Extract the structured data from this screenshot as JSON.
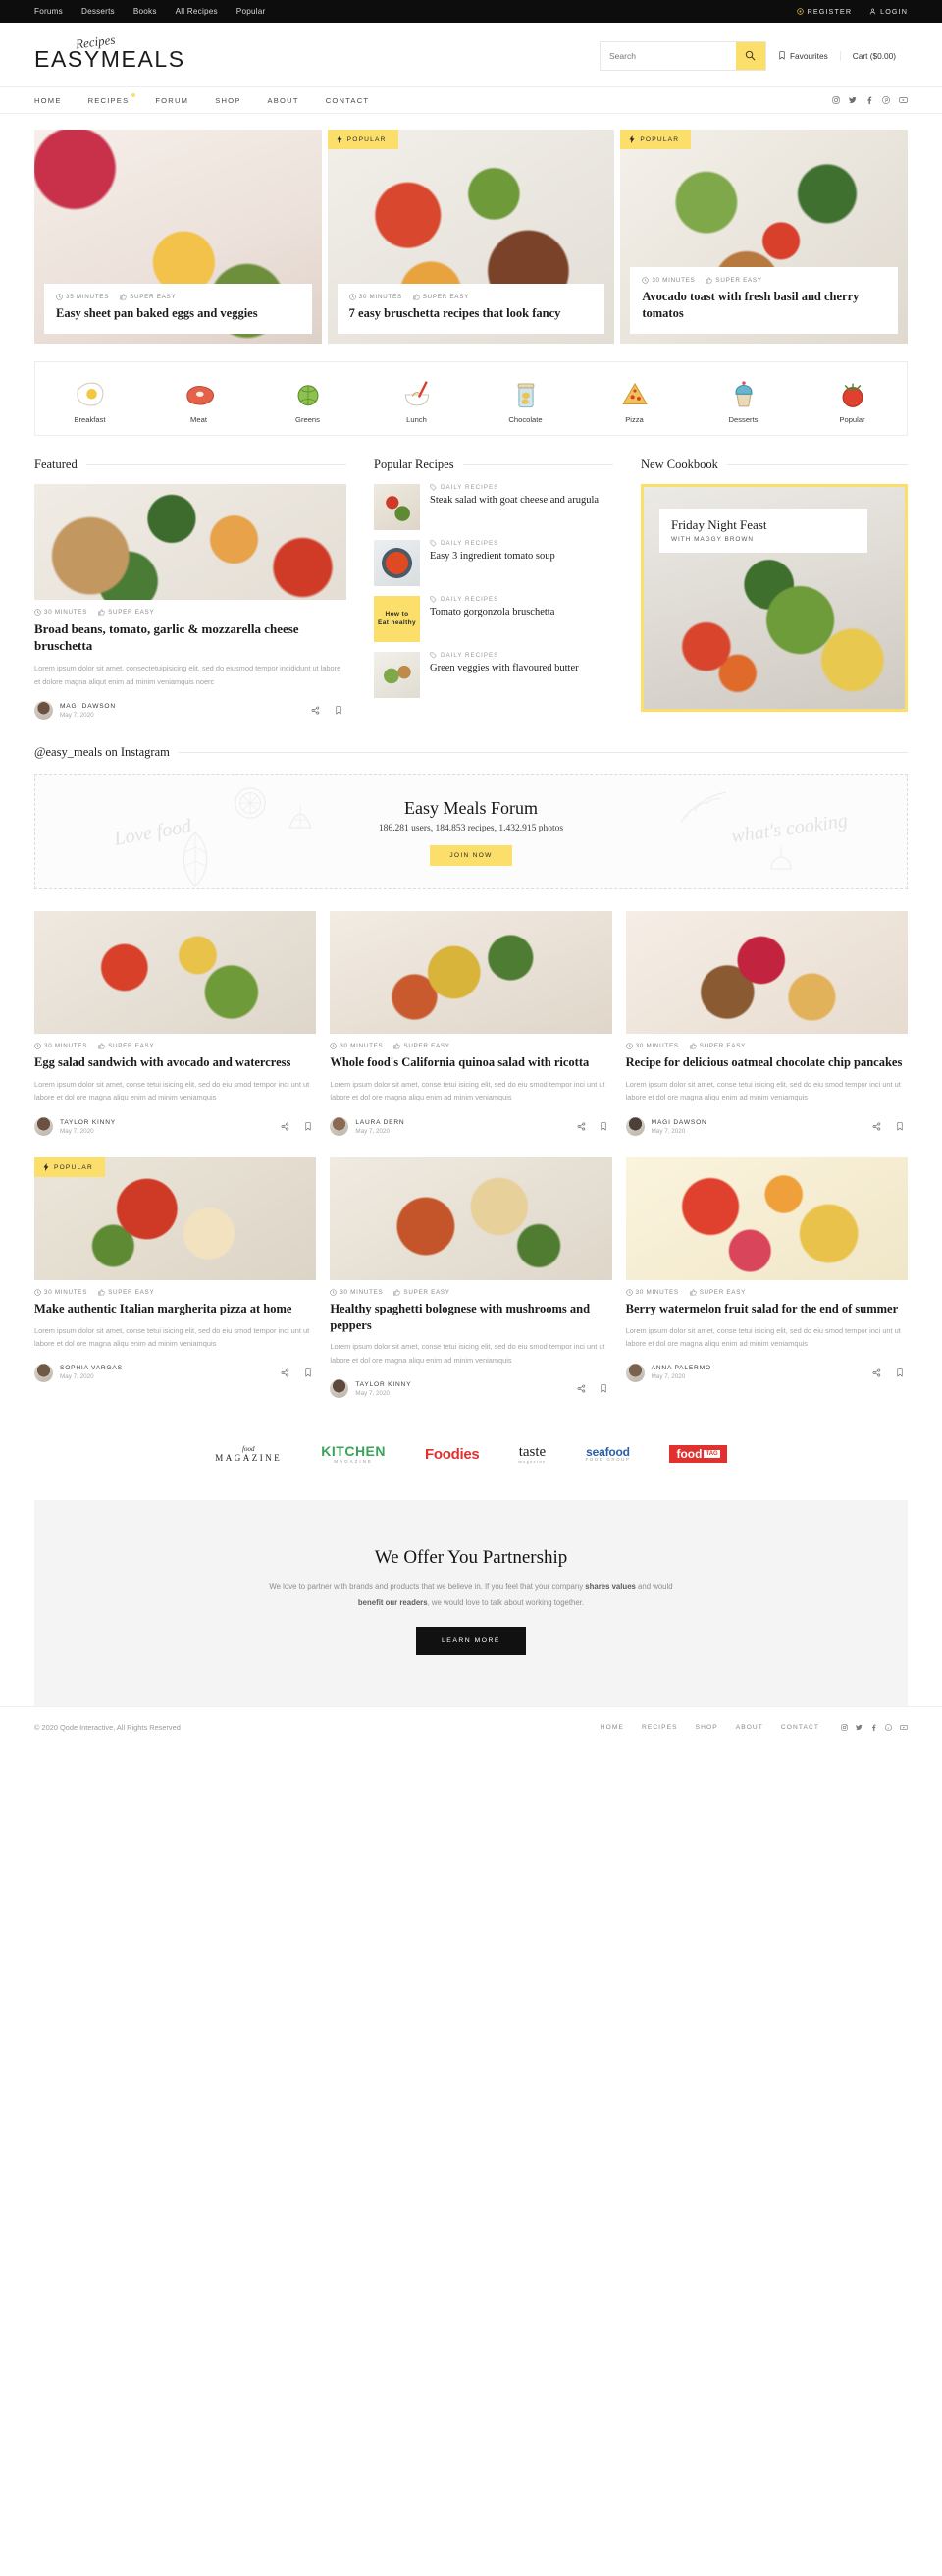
{
  "topbar": {
    "links": [
      "Forums",
      "Desserts",
      "Books",
      "All Recipes",
      "Popular"
    ],
    "register": "REGISTER",
    "login": "LOGIN"
  },
  "brand": {
    "script": "Recipes",
    "name": "EASYMEALS"
  },
  "search": {
    "placeholder": "Search",
    "value": ""
  },
  "header": {
    "favourites": "Favourites",
    "cart": "Cart ($0.00)"
  },
  "nav": {
    "items": [
      {
        "label": "HOME",
        "badge": false
      },
      {
        "label": "RECIPES",
        "badge": true
      },
      {
        "label": "FORUM",
        "badge": false
      },
      {
        "label": "SHOP",
        "badge": false
      },
      {
        "label": "ABOUT",
        "badge": false
      },
      {
        "label": "CONTACT",
        "badge": false
      }
    ],
    "social": [
      "instagram",
      "twitter",
      "facebook",
      "pinterest",
      "youtube"
    ]
  },
  "hero": [
    {
      "badge": "",
      "time": "35 MINUTES",
      "difficulty": "SUPER EASY",
      "title": "Easy sheet pan baked eggs and veggies"
    },
    {
      "badge": "POPULAR",
      "time": "30 MINUTES",
      "difficulty": "SUPER EASY",
      "title": "7 easy bruschetta recipes that look fancy"
    },
    {
      "badge": "POPULAR",
      "time": "30 MINUTES",
      "difficulty": "SUPER EASY",
      "title": "Avocado toast with fresh basil and cherry tomatos"
    }
  ],
  "categories": [
    {
      "label": "Breakfast",
      "icon": "fried-egg-icon"
    },
    {
      "label": "Meat",
      "icon": "steak-icon"
    },
    {
      "label": "Greens",
      "icon": "cabbage-icon"
    },
    {
      "label": "Lunch",
      "icon": "mixing-bowl-icon"
    },
    {
      "label": "Chocolate",
      "icon": "mason-jar-icon"
    },
    {
      "label": "Pizza",
      "icon": "pizza-slice-icon"
    },
    {
      "label": "Desserts",
      "icon": "cupcake-icon"
    },
    {
      "label": "Popular",
      "icon": "tomato-icon"
    }
  ],
  "sections": {
    "featured": "Featured",
    "popular": "Popular Recipes",
    "cookbook": "New Cookbook",
    "instagram": "@easy_meals on Instagram"
  },
  "featured": {
    "time": "30 MINUTES",
    "difficulty": "SUPER EASY",
    "title": "Broad beans, tomato, garlic & mozzarella cheese bruschetta",
    "excerpt": "Lorem ipsum dolor sit amet, consectetuipisicing elit, sed do eiusmod tempor incididunt ut labore et dolore magna aliqut enim ad minim veniamquis noerc",
    "author": "MAGI DAWSON",
    "date": "May 7, 2020"
  },
  "popular_recipes": [
    {
      "category": "DAILY RECIPES",
      "title": "Steak salad with goat cheese and arugula",
      "thumb": "photo"
    },
    {
      "category": "DAILY RECIPES",
      "title": "Easy 3 ingredient tomato soup",
      "thumb": "photo"
    },
    {
      "category": "DAILY RECIPES",
      "title": "Tomato gorgonzola bruschetta",
      "thumb": "card",
      "card_line1": "How to",
      "card_line2": "Eat healthy"
    },
    {
      "category": "DAILY RECIPES",
      "title": "Green veggies with flavoured butter",
      "thumb": "photo"
    }
  ],
  "cookbook": {
    "title": "Friday Night Feast",
    "subtitle": "WITH MAGGY BROWN"
  },
  "forum": {
    "title": "Easy Meals Forum",
    "stats": "186.281 users, 184.853 recipes, 1.432.915 photos",
    "button": "JOIN NOW",
    "deco_left": "Love food",
    "deco_right": "what's cooking"
  },
  "recipes": [
    {
      "badge": "",
      "time": "30 MINUTES",
      "difficulty": "SUPER EASY",
      "title": "Egg salad sandwich with avocado and watercress",
      "excerpt": "Lorem ipsum dolor sit amet, conse tetui isicing elit, sed do eiu smod tempor inci unt ut labore et dol ore magna aliqu enim ad minim veniamquis",
      "author": "TAYLOR KINNY",
      "date": "May 7, 2020"
    },
    {
      "badge": "",
      "time": "30 MINUTES",
      "difficulty": "SUPER EASY",
      "title": "Whole food's California quinoa salad with ricotta",
      "excerpt": "Lorem ipsum dolor sit amet, conse tetui isicing elit, sed do eiu smod tempor inci unt ut labore et dol ore magna aliqu enim ad minim veniamquis",
      "author": "LAURA DERN",
      "date": "May 7, 2020"
    },
    {
      "badge": "",
      "time": "30 MINUTES",
      "difficulty": "SUPER EASY",
      "title": "Recipe for delicious oatmeal chocolate chip pancakes",
      "excerpt": "Lorem ipsum dolor sit amet, conse tetui isicing elit, sed do eiu smod tempor inci unt ut labore et dol ore magna aliqu enim ad minim veniamquis",
      "author": "MAGI DAWSON",
      "date": "May 7, 2020"
    },
    {
      "badge": "POPULAR",
      "time": "30 MINUTES",
      "difficulty": "SUPER EASY",
      "title": "Make authentic Italian margherita pizza at home",
      "excerpt": "Lorem ipsum dolor sit amet, conse tetui isicing elit, sed do eiu smod tempor inci unt ut labore et dol ore magna aliqu enim ad minim veniamquis",
      "author": "SOPHIA VARGAS",
      "date": "May 7, 2020"
    },
    {
      "badge": "",
      "time": "30 MINUTES",
      "difficulty": "SUPER EASY",
      "title": "Healthy spaghetti bolognese with mushrooms and peppers",
      "excerpt": "Lorem ipsum dolor sit amet, conse tetui isicing elit, sed do eiu smod tempor inci unt ut labore et dol ore magna aliqu enim ad minim veniamquis",
      "author": "TAYLOR KINNY",
      "date": "May 7, 2020"
    },
    {
      "badge": "",
      "time": "30 MINUTES",
      "difficulty": "SUPER EASY",
      "title": "Berry watermelon fruit salad for the end of summer",
      "excerpt": "Lorem ipsum dolor sit amet, conse tetui isicing elit, sed do eiu smod tempor inci unt ut labore et dol ore magna aliqu enim ad minim veniamquis",
      "author": "ANNA PALERMO",
      "date": "May 7, 2020"
    }
  ],
  "logos": [
    {
      "name": "food-magazine-logo",
      "line1": "food",
      "line2": "MAGAZINE"
    },
    {
      "name": "kitchen-magazine-logo",
      "line1": "KITCHEN",
      "line2": "MAGAZINE"
    },
    {
      "name": "foodies-logo",
      "line1": "Foodies"
    },
    {
      "name": "taste-magazine-logo",
      "line1": "taste",
      "line2": "magazine"
    },
    {
      "name": "seafood-logo",
      "line1": "seafood",
      "line2": "FOOD GROUP"
    },
    {
      "name": "food-tag-logo",
      "line1": "food",
      "line2": "TAG"
    }
  ],
  "partnership": {
    "title": "We Offer You Partnership",
    "body_1": "We love to partner with brands and products that we believe in. If you feel that your company ",
    "body_bold_1": "shares values",
    "body_2": " and would ",
    "body_bold_2": "benefit our readers",
    "body_3": ", we would love to talk about working together.",
    "button": "LEARN MORE"
  },
  "footer": {
    "copyright": "© 2020 Qode Interactive, All Rights Reserved",
    "links": [
      "HOME",
      "RECIPES",
      "SHOP",
      "ABOUT",
      "CONTACT"
    ]
  },
  "colors": {
    "accent": "#fbdf6a",
    "dark": "#0d0d0d",
    "text": "#1d1d1d",
    "muted": "#a3a3a3"
  }
}
